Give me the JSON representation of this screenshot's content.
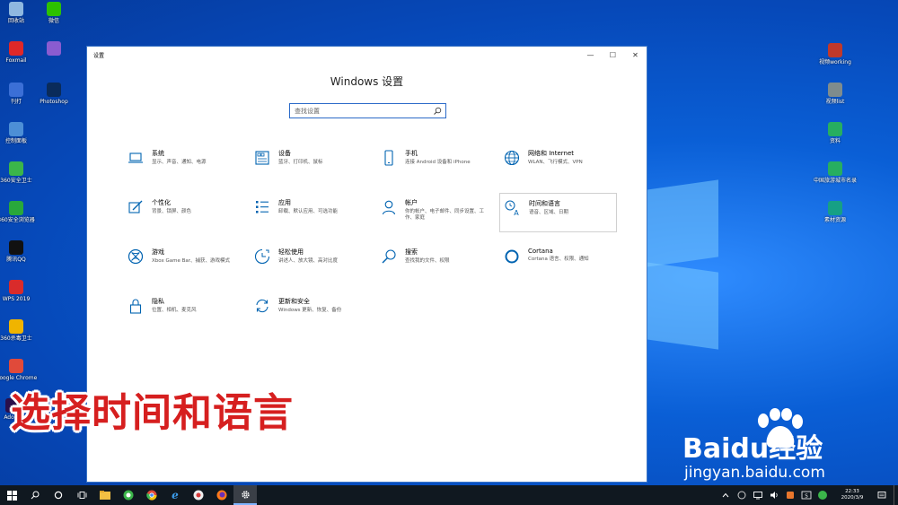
{
  "desktop": {
    "icons_left": [
      {
        "label": "回收站",
        "color": "#8fb8e0"
      },
      {
        "label": "微信",
        "color": "#2dc100"
      },
      {
        "label": "Foxmail",
        "color": "#e02828"
      },
      {
        "label": "",
        "color": "#8a5cd0"
      },
      {
        "label": "刊打",
        "color": "#3b6fd6"
      },
      {
        "label": "Photoshop",
        "color": "#0a2b5a"
      },
      {
        "label": "控制面板",
        "color": "#4d8fd6"
      },
      {
        "label": "360安全卫士",
        "color": "#3bb54a"
      },
      {
        "label": "360安全浏览器",
        "color": "#29a83b"
      },
      {
        "label": "腾讯QQ",
        "color": "#111111"
      },
      {
        "label": "WPS 2019",
        "color": "#d92b2b"
      },
      {
        "label": "360杀毒卫士",
        "color": "#f0b400"
      },
      {
        "label": "Google Chrome",
        "color": "#e04a3a"
      },
      {
        "label": "Ado Pr",
        "color": "#2a0f4a"
      }
    ],
    "icons_right": [
      {
        "label": "视频working",
        "color": "#c0392b"
      },
      {
        "label": "视频list",
        "color": "#7f8c8d"
      },
      {
        "label": "资料",
        "color": "#27ae60"
      },
      {
        "label": "中国旅游城市名录",
        "color": "#27ae60"
      },
      {
        "label": "素材资源",
        "color": "#16a085"
      }
    ]
  },
  "window": {
    "title": "设置",
    "heading": "Windows 设置",
    "search_placeholder": "查找设置",
    "controls": {
      "minimize": "—",
      "maximize": "☐",
      "close": "✕"
    }
  },
  "tiles": [
    {
      "id": "system",
      "name": "系统",
      "desc": "显示、声音、通知、电源",
      "icon": "laptop-icon"
    },
    {
      "id": "devices",
      "name": "设备",
      "desc": "蓝牙、打印机、鼠标",
      "icon": "keyboard-icon"
    },
    {
      "id": "phone",
      "name": "手机",
      "desc": "连接 Android 设备和 iPhone",
      "icon": "phone-icon"
    },
    {
      "id": "network",
      "name": "网络和 Internet",
      "desc": "WLAN、飞行模式、VPN",
      "icon": "globe-icon"
    },
    {
      "id": "personalization",
      "name": "个性化",
      "desc": "背景、锁屏、颜色",
      "icon": "paint-icon"
    },
    {
      "id": "apps",
      "name": "应用",
      "desc": "卸载、默认应用、可选功能",
      "icon": "apps-list-icon"
    },
    {
      "id": "accounts",
      "name": "帐户",
      "desc": "你的帐户、电子邮件、同步设置、工作、家庭",
      "icon": "person-icon"
    },
    {
      "id": "time-language",
      "name": "时间和语言",
      "desc": "语音、区域、日期",
      "icon": "time-language-icon",
      "selected": true
    },
    {
      "id": "gaming",
      "name": "游戏",
      "desc": "Xbox Game Bar、捕获、游戏模式",
      "icon": "xbox-icon"
    },
    {
      "id": "ease-of-access",
      "name": "轻松使用",
      "desc": "讲述人、放大镜、高对比度",
      "icon": "ease-of-access-icon"
    },
    {
      "id": "search",
      "name": "搜索",
      "desc": "查找我的文件、权限",
      "icon": "search-icon"
    },
    {
      "id": "cortana",
      "name": "Cortana",
      "desc": "Cortana 语言、权限、通知",
      "icon": "cortana-icon"
    },
    {
      "id": "privacy",
      "name": "隐私",
      "desc": "位置、相机、麦克风",
      "icon": "lock-icon"
    },
    {
      "id": "update-security",
      "name": "更新和安全",
      "desc": "Windows 更新、恢复、备份",
      "icon": "refresh-icon"
    }
  ],
  "caption": "选择时间和语言",
  "watermark": {
    "brand": "Baidu经验",
    "url": "jingyan.baidu.com"
  },
  "taskbar": {
    "clock_time": "22:33",
    "clock_date": "2020/3/9",
    "accent": "#7fb4ff"
  }
}
